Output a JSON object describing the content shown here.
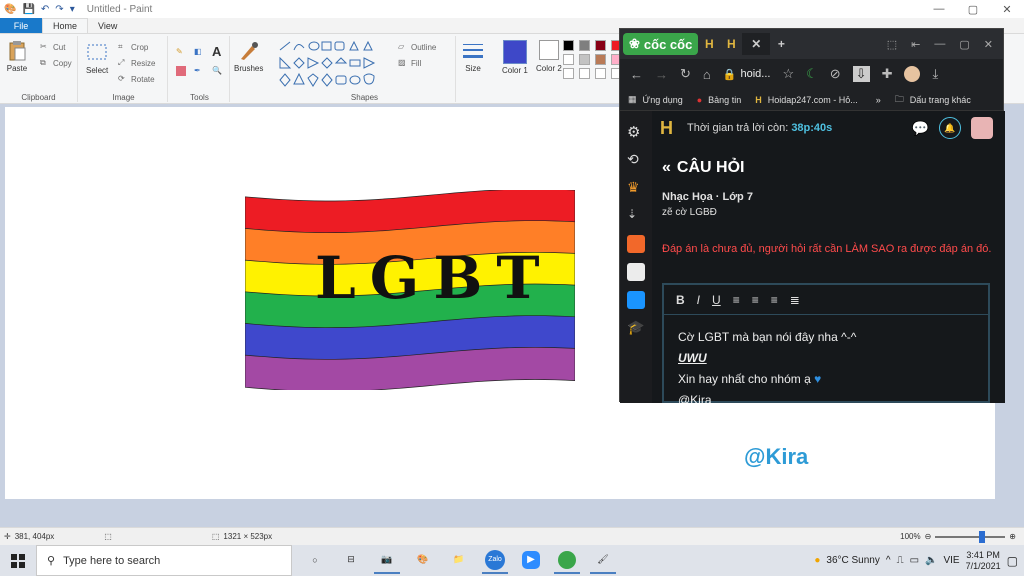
{
  "paint": {
    "title": "Untitled - Paint",
    "tabs": {
      "file": "File",
      "home": "Home",
      "view": "View"
    },
    "clipboard": {
      "paste": "Paste",
      "cut": "Cut",
      "copy": "Copy",
      "group": "Clipboard"
    },
    "image": {
      "select": "Select",
      "crop": "Crop",
      "resize": "Resize",
      "rotate": "Rotate",
      "group": "Image"
    },
    "tools": {
      "group": "Tools"
    },
    "brushes": {
      "label": "Brushes"
    },
    "shapes": {
      "outline": "Outline",
      "fill": "Fill",
      "group": "Shapes"
    },
    "size": {
      "label": "Size"
    },
    "colors": {
      "color1": "Color 1",
      "color2": "Color 2",
      "color1_value": "#3e48c8",
      "palette": [
        "#000000",
        "#7f7f7f",
        "#880015",
        "#ed1c24",
        "#ffffff",
        "#c3c3c3",
        "#b97a57",
        "#ffaec9"
      ]
    },
    "status": {
      "pos": "381, 404px",
      "size": "1321 × 523px",
      "zoom": "100%"
    },
    "canvas_text": {
      "flag_text": "LGBT",
      "signature": "@Kira"
    },
    "flag_colors": [
      "#ed1c24",
      "#ff7f27",
      "#fff200",
      "#22b14c",
      "#3f48cc",
      "#a349a4"
    ]
  },
  "taskbar": {
    "search_placeholder": "Type here to search",
    "weather": "36°C  Sunny",
    "lang": "VIE",
    "time": "3:41 PM",
    "date": "7/1/2021"
  },
  "browser": {
    "brand": "cốc cốc",
    "tab_letter": "H",
    "address": "hoid...",
    "bookmarks": {
      "apps": "Ứng dụng",
      "news": "Bảng tin",
      "site": "Hoidap247.com - Hỏ...",
      "more": "»",
      "folder": "Dấu trang khác"
    },
    "page": {
      "timer_label": "Thời gian trả lời còn:",
      "timer_value": "38p:40s",
      "question_header": "CÂU HỎI",
      "subject": "Nhạc Họa · Lớp 7",
      "question": "zẽ cờ LGBĐ",
      "warning": "Đáp án là chưa đủ, người hỏi rất cần LÀM SAO ra được đáp án đó.",
      "editor": {
        "line1": "Cờ LGBT mà bạn nói đây nha ^-^",
        "line2": "UWU",
        "line3": "Xin hay nhất cho nhóm ạ",
        "line4": "@Kira"
      }
    }
  }
}
